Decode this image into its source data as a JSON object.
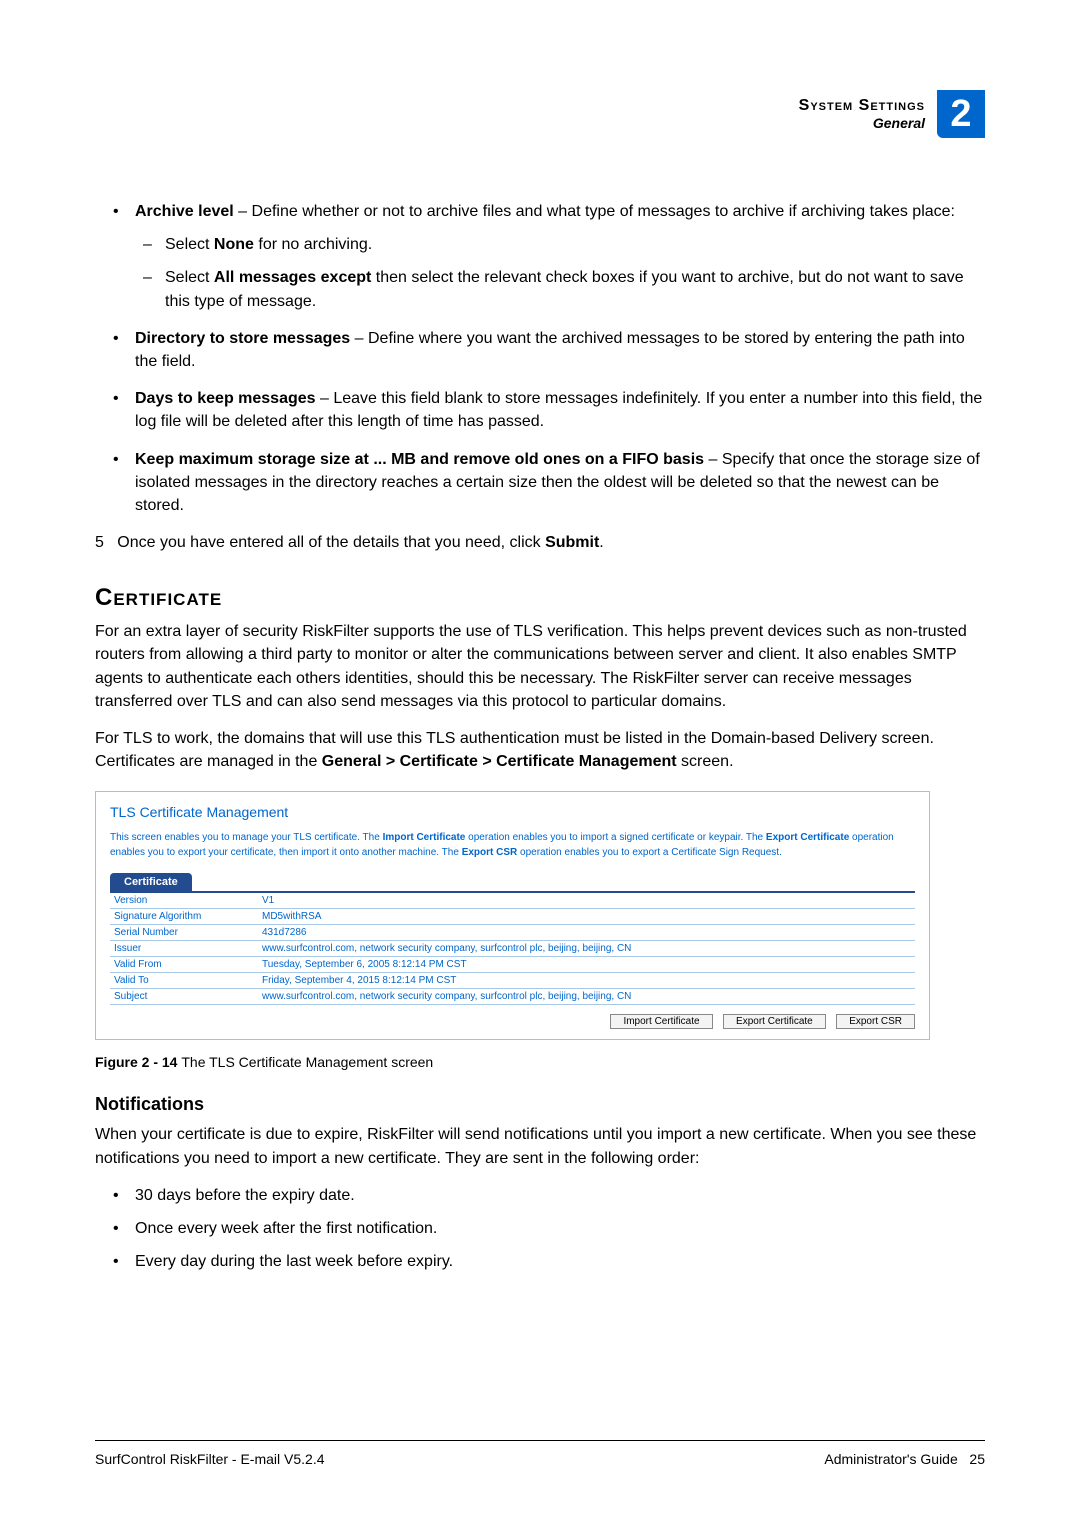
{
  "header": {
    "title": "System Settings",
    "subtitle": "General",
    "chapter": "2"
  },
  "bullets": {
    "archive_level_pre": "Archive level",
    "archive_level_post": " – Define whether or not to archive files and what type of messages to archive if archiving takes place:",
    "none_pre": "Select ",
    "none_bold": "None",
    "none_post": " for no archiving.",
    "allmsg_pre": "Select ",
    "allmsg_bold": "All messages except",
    "allmsg_post": " then select the relevant check boxes if you want to archive, but do not want to save this type of message.",
    "dir_bold": "Directory to store messages",
    "dir_post": " – Define where you want the archived messages to be stored by entering the path into the field.",
    "days_bold": "Days to keep messages",
    "days_post": " – Leave this field blank to store messages indefinitely. If you enter a number into this field, the log file will be deleted after this length of time has passed.",
    "keep_bold": "Keep maximum storage size at ... MB and remove old ones on a FIFO basis",
    "keep_post": " – Specify that once the storage size of isolated messages in the directory reaches a certain size then the oldest will be deleted so that the newest can be stored."
  },
  "step5_num": "5",
  "step5_pre": "Once you have entered all of the details that you need, click ",
  "step5_bold": "Submit",
  "step5_post": ".",
  "cert_heading": "Certificate",
  "cert_p1": "For an extra layer of security RiskFilter supports the use of TLS verification. This helps prevent devices such as non-trusted routers from allowing a third party to monitor or alter the communications between server and client. It also enables SMTP agents to authenticate each others identities, should this be necessary. The RiskFilter server can receive messages transferred over TLS and can also send messages via this protocol to particular domains.",
  "cert_p2_pre": "For TLS to work, the domains that will use this TLS authentication must be listed in the Domain-based Delivery screen. Certificates are managed in the ",
  "cert_p2_bold": "General > Certificate > Certificate Management",
  "cert_p2_post": " screen.",
  "figure": {
    "panel_title": "TLS Certificate Management",
    "desc_pre": "This screen enables you to manage your TLS certificate. The ",
    "desc_b1": "Import Certificate",
    "desc_mid1": " operation enables you to import a signed certificate or keypair. The ",
    "desc_b2": "Export Certificate",
    "desc_mid2": " operation enables you to export your certificate, then import it onto another machine. The ",
    "desc_b3": "Export CSR",
    "desc_post": " operation enables you to export a Certificate Sign Request.",
    "tab": "Certificate",
    "rows": [
      {
        "k": "Version",
        "v": "V1"
      },
      {
        "k": "Signature Algorithm",
        "v": "MD5withRSA"
      },
      {
        "k": "Serial Number",
        "v": "431d7286"
      },
      {
        "k": "Issuer",
        "v": "www.surfcontrol.com, network security company, surfcontrol plc, beijing, beijing, CN"
      },
      {
        "k": "Valid From",
        "v": "Tuesday, September 6, 2005 8:12:14 PM CST"
      },
      {
        "k": "Valid To",
        "v": "Friday, September 4, 2015 8:12:14 PM CST"
      },
      {
        "k": "Subject",
        "v": "www.surfcontrol.com, network security company, surfcontrol plc, beijing, beijing, CN"
      }
    ],
    "btn1": "Import Certificate",
    "btn2": "Export Certificate",
    "btn3": "Export CSR",
    "caption_pre": "Figure 2 - 14 ",
    "caption_post": "The TLS Certificate Management screen"
  },
  "notif_heading": "Notifications",
  "notif_p": "When your certificate is due to expire, RiskFilter will send notifications until you import a new certificate. When you see these notifications you need to import a new certificate. They are sent in the following order:",
  "notif_items": [
    "30 days before the expiry date.",
    "Once every week after the first notification.",
    "Every day during the last week before expiry."
  ],
  "footer": {
    "left": "SurfControl RiskFilter - E-mail V5.2.4",
    "right_label": "Administrator's Guide",
    "page": "25"
  }
}
